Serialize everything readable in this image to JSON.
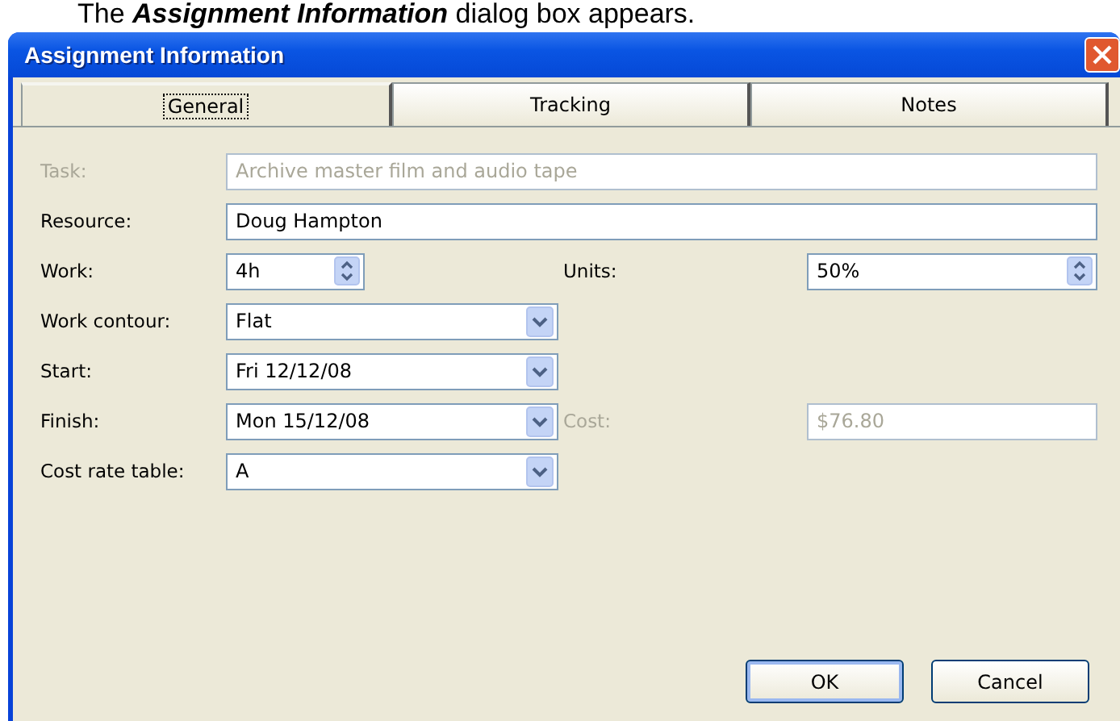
{
  "caption": "The **Assignment Information** dialog box appears.",
  "window": {
    "title": "Assignment Information"
  },
  "tabs": [
    {
      "label": "General",
      "selected": true
    },
    {
      "label": "Tracking",
      "selected": false
    },
    {
      "label": "Notes",
      "selected": false
    }
  ],
  "rows": [
    {
      "fields": [
        {
          "kind": "text",
          "label": "Task:",
          "value": "Archive master film and audio tape",
          "disabled": true,
          "wide": true
        }
      ]
    },
    {
      "fields": [
        {
          "kind": "text",
          "label": "Resource:",
          "value": "Doug Hampton",
          "disabled": false,
          "wide": true
        }
      ]
    },
    {
      "fields": [
        {
          "kind": "spin",
          "label": "Work:",
          "value": "4h",
          "disabled": false,
          "wide": false
        },
        {
          "kind": "spin",
          "label": "Units:",
          "value": "50%",
          "disabled": false,
          "wide": false
        }
      ]
    },
    {
      "fields": [
        {
          "kind": "combo",
          "label": "Work contour:",
          "value": "Flat",
          "disabled": false,
          "wide": false
        }
      ]
    },
    {
      "fields": [
        {
          "kind": "combo",
          "label": "Start:",
          "value": "Fri 12/12/08",
          "disabled": false,
          "wide": false
        }
      ]
    },
    {
      "fields": [
        {
          "kind": "combo",
          "label": "Finish:",
          "value": "Mon 15/12/08",
          "disabled": false,
          "wide": false
        },
        {
          "kind": "text",
          "label": "Cost:",
          "value": "$76.80",
          "disabled": true,
          "wide": false
        }
      ]
    },
    {
      "fields": [
        {
          "kind": "combo",
          "label": "Cost rate table:",
          "value": "A",
          "disabled": false,
          "wide": false
        }
      ]
    }
  ],
  "buttons": [
    {
      "label": "OK",
      "default": true
    },
    {
      "label": "Cancel",
      "default": false
    }
  ]
}
